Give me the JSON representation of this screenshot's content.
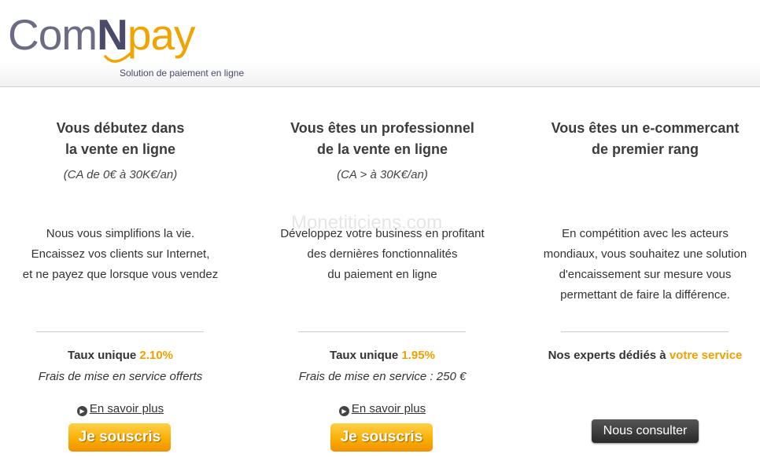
{
  "header": {
    "logo": {
      "com": "Com",
      "n": "N",
      "pay": "pay"
    },
    "tagline": "Solution de paiement en ligne"
  },
  "watermark": "Monetiticiens.com",
  "offers": [
    {
      "title_lines": [
        "Vous débutez dans",
        "la vente en ligne"
      ],
      "subtitle": "(CA de 0€ à 30K€/an)",
      "description_lines": [
        "Nous vous simplifions la vie.",
        "Encaissez vos clients sur Internet,",
        "et ne payez que lorsque vous vendez"
      ],
      "rate_label": "Taux unique",
      "rate_value": "2.10%",
      "fees": "Frais de mise en service offerts",
      "more_link": "En savoir plus",
      "button": "Je souscris"
    },
    {
      "title_lines": [
        "Vous êtes un professionnel",
        "de la vente en ligne"
      ],
      "subtitle": "(CA > à 30K€/an)",
      "description_lines": [
        "Développez votre business en profitant",
        "des dernières fonctionnalités",
        "du paiement en ligne"
      ],
      "rate_label": "Taux unique",
      "rate_value": "1.95%",
      "fees": "Frais de mise en service : 250 €",
      "more_link": "En savoir plus",
      "button": "Je souscris"
    },
    {
      "title_lines": [
        "Vous êtes un e-commercant",
        "de premier rang"
      ],
      "subtitle": "",
      "description_lines": [
        "En compétition avec les acteurs",
        "mondiaux, vous souhaitez une solution",
        "d'encaissement sur mesure vous",
        "permettant de faire la différence."
      ],
      "rate_label": "Nos experts dédiés à",
      "rate_value": "votre service",
      "button": "Nous consulter"
    }
  ],
  "colors": {
    "accent": "#f0a000",
    "logo_grey": "#6b6b83",
    "button_dark": "#2a2a2a"
  },
  "icons": {
    "more_link": "circle-arrow-right-icon"
  }
}
